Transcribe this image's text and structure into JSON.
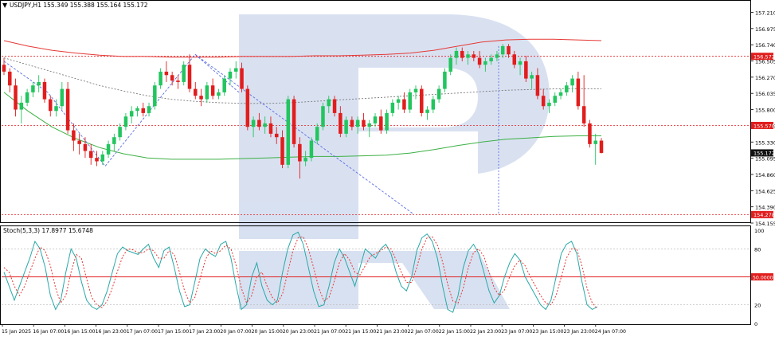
{
  "header": {
    "symbol_line": "USDJPY,H1  155.349 155.388 155.164 155.172"
  },
  "colors": {
    "bull": "#22c55e",
    "bear": "#e11d1d",
    "ma_slow": "#3cb043",
    "ma_fast": "#e53935",
    "level_line": "#e11d1d",
    "trend_line": "#5b6ee1",
    "stoch_main": "#2aa8a8",
    "stoch_signal": "#e53935",
    "watermark": "#b9c9e6"
  },
  "chart_data": [
    {
      "type": "candlestick",
      "title": "USDJPY,H1",
      "ohlc": {
        "open": 155.349,
        "high": 155.388,
        "low": 155.164,
        "close": 155.172
      },
      "ylim": [
        154.155,
        157.25
      ],
      "y_ticks": [
        "157.210",
        "156.975",
        "156.740",
        "156.505",
        "156.270",
        "156.035",
        "155.800",
        "155.565",
        "155.330",
        "155.095",
        "154.860",
        "154.625",
        "154.390",
        "154.155"
      ],
      "x_ticks": [
        "15 Jan 2025",
        "16 Jan 07:00",
        "16 Jan 15:00",
        "16 Jan 23:00",
        "17 Jan 07:00",
        "17 Jan 15:00",
        "17 Jan 23:00",
        "20 Jan 07:00",
        "20 Jan 15:00",
        "20 Jan 23:00",
        "21 Jan 07:00",
        "21 Jan 15:00",
        "21 Jan 23:00",
        "22 Jan 07:00",
        "22 Jan 15:00",
        "22 Jan 23:00",
        "23 Jan 07:00",
        "23 Jan 15:00",
        "23 Jan 23:00",
        "24 Jan 07:00"
      ],
      "price_labels": [
        {
          "label": "156.572",
          "value": 156.572,
          "style": "red"
        },
        {
          "label": "155.570",
          "value": 155.57,
          "style": "red"
        },
        {
          "label": "155.172",
          "value": 155.172,
          "style": "dark"
        },
        {
          "label": "154.278",
          "value": 154.278,
          "style": "red"
        }
      ],
      "level_lines": [
        156.572,
        155.57,
        154.278
      ],
      "candles": [
        [
          156.45,
          156.55,
          156.3,
          156.35
        ],
        [
          156.35,
          156.4,
          156.05,
          156.15
        ],
        [
          156.15,
          156.25,
          155.7,
          155.8
        ],
        [
          155.8,
          156.0,
          155.6,
          155.9
        ],
        [
          155.9,
          156.1,
          155.85,
          156.05
        ],
        [
          156.05,
          156.2,
          155.98,
          156.15
        ],
        [
          156.15,
          156.3,
          156.05,
          156.2
        ],
        [
          156.2,
          156.25,
          155.9,
          155.95
        ],
        [
          155.95,
          156.0,
          155.7,
          155.78
        ],
        [
          155.78,
          155.95,
          155.7,
          155.85
        ],
        [
          155.85,
          156.2,
          155.8,
          156.1
        ],
        [
          156.1,
          156.2,
          155.45,
          155.5
        ],
        [
          155.5,
          155.6,
          155.2,
          155.35
        ],
        [
          155.35,
          155.45,
          155.15,
          155.3
        ],
        [
          155.3,
          155.4,
          155.1,
          155.2
        ],
        [
          155.2,
          155.3,
          155.0,
          155.1
        ],
        [
          155.1,
          155.2,
          154.98,
          155.05
        ],
        [
          155.05,
          155.2,
          155.0,
          155.15
        ],
        [
          155.15,
          155.35,
          155.1,
          155.3
        ],
        [
          155.3,
          155.45,
          155.2,
          155.4
        ],
        [
          155.4,
          155.6,
          155.35,
          155.55
        ],
        [
          155.55,
          155.75,
          155.5,
          155.7
        ],
        [
          155.7,
          155.85,
          155.6,
          155.78
        ],
        [
          155.78,
          155.85,
          155.7,
          155.82
        ],
        [
          155.82,
          155.9,
          155.7,
          155.75
        ],
        [
          155.75,
          155.9,
          155.7,
          155.85
        ],
        [
          155.85,
          156.2,
          155.8,
          156.15
        ],
        [
          156.15,
          156.4,
          156.1,
          156.35
        ],
        [
          156.35,
          156.5,
          156.2,
          156.3
        ],
        [
          156.3,
          156.35,
          156.15,
          156.22
        ],
        [
          156.22,
          156.3,
          156.1,
          156.2
        ],
        [
          156.2,
          156.5,
          156.15,
          156.45
        ],
        [
          156.45,
          156.6,
          156.05,
          156.1
        ],
        [
          156.1,
          156.2,
          155.95,
          156.0
        ],
        [
          156.0,
          156.1,
          155.85,
          155.95
        ],
        [
          155.95,
          156.2,
          155.9,
          156.15
        ],
        [
          156.15,
          156.25,
          155.95,
          156.0
        ],
        [
          156.0,
          156.1,
          155.95,
          156.05
        ],
        [
          156.05,
          156.3,
          156.0,
          156.25
        ],
        [
          156.25,
          156.4,
          156.15,
          156.35
        ],
        [
          156.35,
          156.5,
          156.25,
          156.4
        ],
        [
          156.4,
          156.48,
          156.05,
          156.1
        ],
        [
          156.1,
          156.15,
          155.5,
          155.55
        ],
        [
          155.55,
          155.7,
          155.4,
          155.65
        ],
        [
          155.65,
          155.75,
          155.5,
          155.55
        ],
        [
          155.55,
          155.7,
          155.45,
          155.6
        ],
        [
          155.6,
          155.7,
          155.4,
          155.45
        ],
        [
          155.45,
          155.55,
          155.3,
          155.4
        ],
        [
          155.4,
          155.5,
          154.95,
          155.0
        ],
        [
          155.0,
          156.0,
          154.95,
          155.95
        ],
        [
          155.95,
          156.0,
          155.25,
          155.3
        ],
        [
          155.3,
          155.4,
          154.8,
          155.05
        ],
        [
          155.05,
          155.2,
          154.98,
          155.1
        ],
        [
          155.1,
          155.4,
          155.05,
          155.35
        ],
        [
          155.35,
          155.6,
          155.3,
          155.55
        ],
        [
          155.55,
          155.9,
          155.5,
          155.85
        ],
        [
          155.85,
          156.0,
          155.75,
          155.95
        ],
        [
          155.95,
          156.0,
          155.7,
          155.75
        ],
        [
          155.75,
          155.85,
          155.4,
          155.45
        ],
        [
          155.45,
          155.7,
          155.4,
          155.65
        ],
        [
          155.65,
          155.7,
          155.5,
          155.55
        ],
        [
          155.55,
          155.7,
          155.45,
          155.65
        ],
        [
          155.65,
          155.75,
          155.5,
          155.55
        ],
        [
          155.55,
          155.65,
          155.4,
          155.6
        ],
        [
          155.6,
          155.75,
          155.55,
          155.7
        ],
        [
          155.7,
          155.8,
          155.45,
          155.5
        ],
        [
          155.5,
          155.8,
          155.45,
          155.75
        ],
        [
          155.75,
          155.95,
          155.7,
          155.9
        ],
        [
          155.9,
          156.0,
          155.8,
          155.95
        ],
        [
          155.95,
          156.05,
          155.75,
          155.8
        ],
        [
          155.8,
          156.1,
          155.75,
          156.05
        ],
        [
          156.05,
          156.15,
          155.95,
          156.1
        ],
        [
          156.1,
          156.15,
          155.7,
          155.75
        ],
        [
          155.75,
          155.85,
          155.65,
          155.8
        ],
        [
          155.8,
          156.0,
          155.75,
          155.95
        ],
        [
          155.95,
          156.15,
          155.9,
          156.1
        ],
        [
          156.1,
          156.4,
          156.05,
          156.35
        ],
        [
          156.35,
          156.6,
          156.3,
          156.55
        ],
        [
          156.55,
          156.7,
          156.45,
          156.65
        ],
        [
          156.65,
          156.7,
          156.5,
          156.55
        ],
        [
          156.55,
          156.65,
          156.45,
          156.6
        ],
        [
          156.6,
          156.65,
          156.5,
          156.55
        ],
        [
          156.55,
          156.65,
          156.4,
          156.45
        ],
        [
          156.45,
          156.55,
          156.35,
          156.5
        ],
        [
          156.5,
          156.6,
          156.45,
          156.55
        ],
        [
          156.55,
          156.65,
          156.5,
          156.6
        ],
        [
          156.6,
          156.75,
          156.55,
          156.72
        ],
        [
          156.72,
          156.75,
          156.55,
          156.6
        ],
        [
          156.6,
          156.65,
          156.4,
          156.45
        ],
        [
          156.45,
          156.55,
          156.3,
          156.5
        ],
        [
          156.5,
          156.58,
          156.2,
          156.25
        ],
        [
          156.25,
          156.35,
          156.1,
          156.3
        ],
        [
          156.3,
          156.4,
          155.95,
          156.0
        ],
        [
          156.0,
          156.1,
          155.8,
          155.85
        ],
        [
          155.85,
          155.95,
          155.75,
          155.9
        ],
        [
          155.9,
          156.05,
          155.85,
          156.0
        ],
        [
          156.0,
          156.1,
          155.95,
          156.05
        ],
        [
          156.05,
          156.2,
          156.0,
          156.15
        ],
        [
          156.15,
          156.3,
          156.05,
          156.25
        ],
        [
          156.25,
          156.35,
          155.8,
          155.85
        ],
        [
          155.85,
          156.3,
          155.55,
          155.6
        ],
        [
          155.6,
          155.65,
          155.25,
          155.3
        ],
        [
          155.3,
          155.45,
          155.0,
          155.35
        ],
        [
          155.35,
          155.388,
          155.164,
          155.172
        ]
      ],
      "moving_averages": [
        {
          "name": "",
          "color": "#e53935",
          "values": [
            156.8,
            156.72,
            156.66,
            156.62,
            156.59,
            156.57,
            156.57,
            156.56,
            156.56,
            156.56,
            156.57,
            156.57,
            156.57,
            156.58,
            156.58,
            156.59,
            156.6,
            156.62,
            156.66,
            156.72,
            156.78,
            156.81,
            156.82,
            156.82,
            156.81,
            156.8
          ]
        },
        {
          "name": "",
          "color": "#3cb043",
          "values": [
            156.05,
            155.78,
            155.55,
            155.38,
            155.25,
            155.16,
            155.1,
            155.08,
            155.08,
            155.08,
            155.09,
            155.1,
            155.11,
            155.12,
            155.12,
            155.13,
            155.14,
            155.17,
            155.22,
            155.28,
            155.33,
            155.37,
            155.39,
            155.41,
            155.42,
            155.42
          ]
        },
        {
          "name": "",
          "color": "#7a7a7a",
          "values": [
            156.55,
            156.45,
            156.35,
            156.25,
            156.15,
            156.07,
            156.0,
            155.95,
            155.92,
            155.9,
            155.89,
            155.89,
            155.9,
            155.92,
            155.94,
            155.96,
            155.98,
            156.0,
            156.02,
            156.04,
            156.06,
            156.08,
            156.09,
            156.1,
            156.1,
            156.1
          ]
        }
      ]
    },
    {
      "type": "line",
      "title": "Stoch(5,3,3) 17.8977 15.6748",
      "ylim": [
        0,
        100
      ],
      "y_ticks": [
        "100",
        "80",
        "50.0000",
        "20",
        "0"
      ],
      "level_lines": [
        80,
        50,
        20
      ],
      "series": [
        {
          "name": "",
          "color": "#2aa8a8",
          "values": [
            55,
            40,
            25,
            40,
            55,
            70,
            88,
            80,
            60,
            30,
            15,
            25,
            55,
            80,
            70,
            45,
            25,
            18,
            15,
            20,
            35,
            55,
            75,
            82,
            78,
            76,
            74,
            80,
            85,
            70,
            60,
            78,
            82,
            60,
            35,
            18,
            20,
            45,
            70,
            80,
            75,
            72,
            85,
            88,
            70,
            40,
            15,
            20,
            50,
            65,
            40,
            25,
            20,
            25,
            55,
            80,
            95,
            98,
            85,
            60,
            35,
            18,
            20,
            40,
            65,
            80,
            70,
            55,
            40,
            60,
            80,
            75,
            70,
            80,
            85,
            75,
            55,
            40,
            35,
            50,
            78,
            92,
            96,
            88,
            70,
            40,
            15,
            12,
            30,
            60,
            78,
            85,
            75,
            55,
            35,
            22,
            30,
            50,
            65,
            75,
            68,
            50,
            40,
            30,
            20,
            15,
            25,
            50,
            75,
            85,
            88,
            75,
            45,
            20,
            15,
            17.9
          ]
        },
        {
          "name": "",
          "color": "#e53935",
          "values": [
            60,
            55,
            40,
            30,
            40,
            55,
            70,
            82,
            78,
            62,
            38,
            22,
            30,
            55,
            74,
            70,
            48,
            28,
            20,
            17,
            24,
            38,
            56,
            72,
            80,
            79,
            76,
            76,
            80,
            78,
            70,
            70,
            78,
            74,
            55,
            35,
            22,
            28,
            48,
            68,
            78,
            75,
            78,
            84,
            80,
            62,
            38,
            22,
            30,
            50,
            55,
            40,
            28,
            22,
            32,
            55,
            78,
            92,
            93,
            80,
            60,
            38,
            24,
            28,
            45,
            65,
            75,
            68,
            55,
            52,
            62,
            72,
            75,
            78,
            82,
            80,
            68,
            55,
            44,
            44,
            60,
            80,
            92,
            93,
            84,
            66,
            42,
            24,
            22,
            38,
            60,
            76,
            80,
            72,
            55,
            38,
            30,
            36,
            50,
            62,
            68,
            62,
            50,
            40,
            30,
            22,
            20,
            30,
            50,
            70,
            80,
            80,
            62,
            38,
            22,
            15.7
          ]
        }
      ]
    }
  ]
}
